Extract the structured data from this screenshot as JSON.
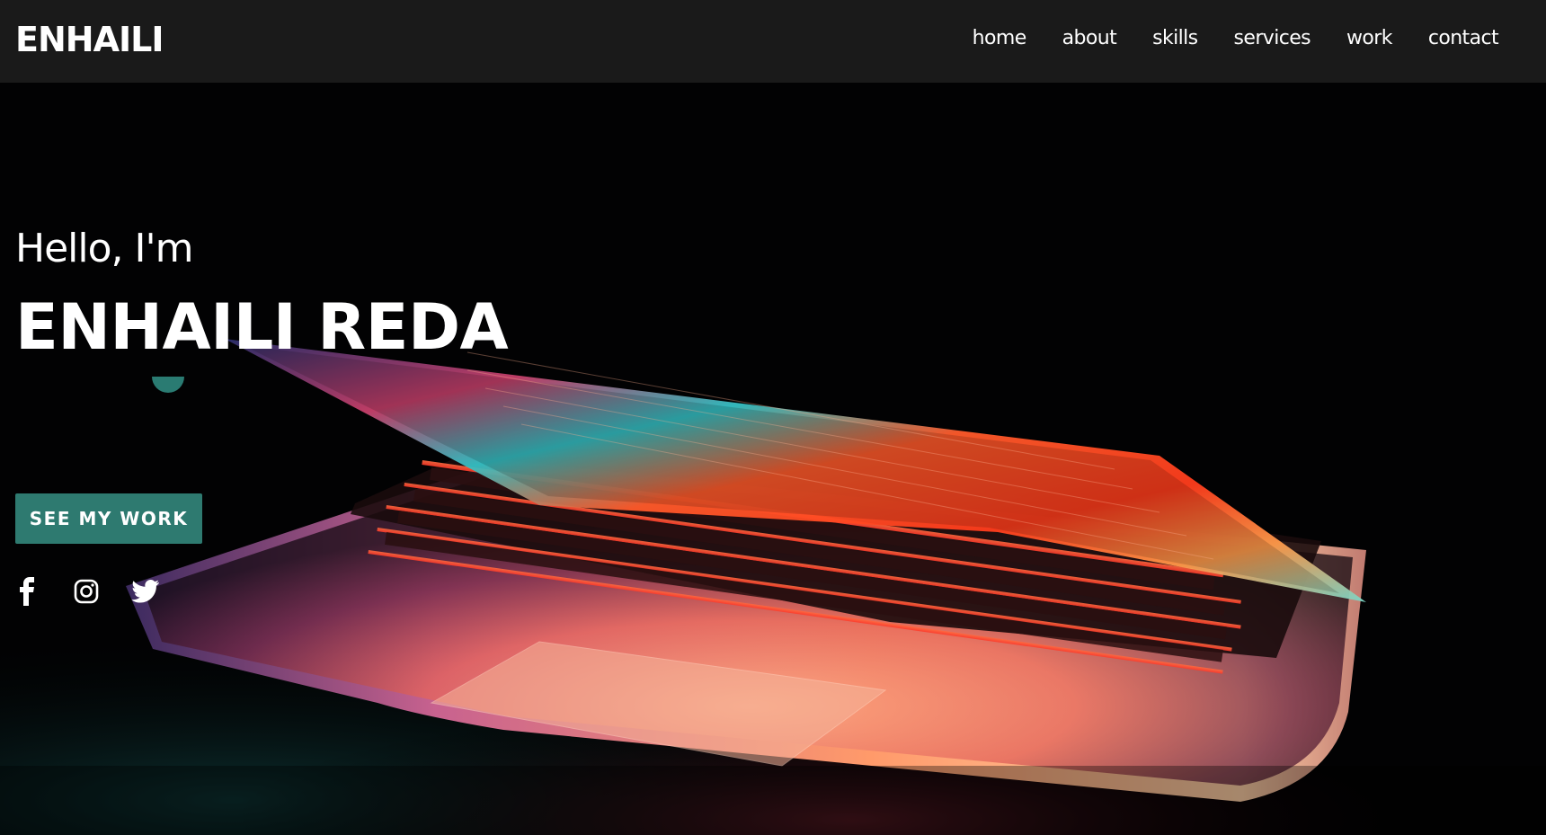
{
  "brand": {
    "logo": "ENHAILI"
  },
  "nav": {
    "items": [
      {
        "label": "home"
      },
      {
        "label": "about"
      },
      {
        "label": "skills"
      },
      {
        "label": "services"
      },
      {
        "label": "work"
      },
      {
        "label": "contact"
      }
    ]
  },
  "hero": {
    "greeting": "Hello, I'm",
    "name": "ENHAILI REDA",
    "cta_label": "SEE MY WORK",
    "background_image": "laptop-keyboard-glow"
  },
  "socials": [
    {
      "icon": "facebook-icon"
    },
    {
      "icon": "instagram-icon"
    },
    {
      "icon": "twitter-icon"
    }
  ],
  "colors": {
    "navbar": "#1a1a1a",
    "accent": "#2e7a70",
    "text": "#ffffff",
    "background": "#000000"
  }
}
